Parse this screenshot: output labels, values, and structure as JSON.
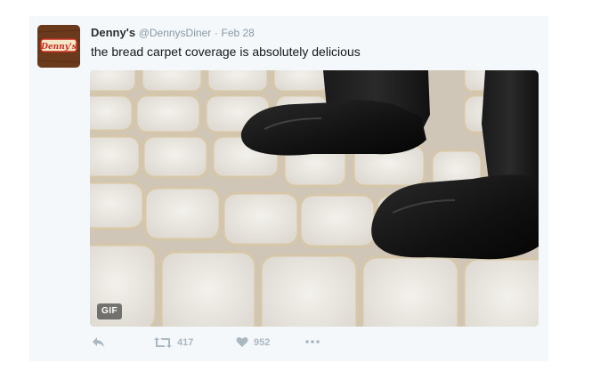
{
  "tweet": {
    "name": "Denny's",
    "handle": "@DennysDiner",
    "separator": "·",
    "date": "Feb 28",
    "text": "the bread carpet coverage is absolutely delicious",
    "avatar_logo_text": "Denny's",
    "media": {
      "badge": "GIF"
    },
    "actions": {
      "reply_icon": "reply-icon",
      "retweet_icon": "retweet-icon",
      "retweet_count": "417",
      "like_icon": "heart-icon",
      "like_count": "952",
      "more_icon": "more-icon"
    }
  },
  "colors": {
    "card_bg": "#f5f8fa",
    "name": "#292f33",
    "muted": "#8899a6",
    "action": "#aab8c2",
    "brand": "#6b3a1c"
  }
}
